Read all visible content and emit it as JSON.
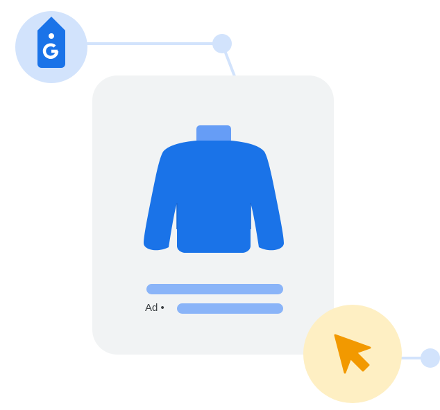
{
  "card": {
    "ad_label": "Ad •"
  },
  "icons": {
    "tag": "google-tag-icon",
    "product": "sweater-icon",
    "cursor": "cursor-arrow-icon"
  },
  "colors": {
    "primary_blue": "#1a73e8",
    "light_blue": "#8ab4f8",
    "pale_blue": "#d2e3fc",
    "card_bg": "#f1f3f4",
    "cursor_orange": "#f29900",
    "cursor_bg": "#feefc3"
  }
}
